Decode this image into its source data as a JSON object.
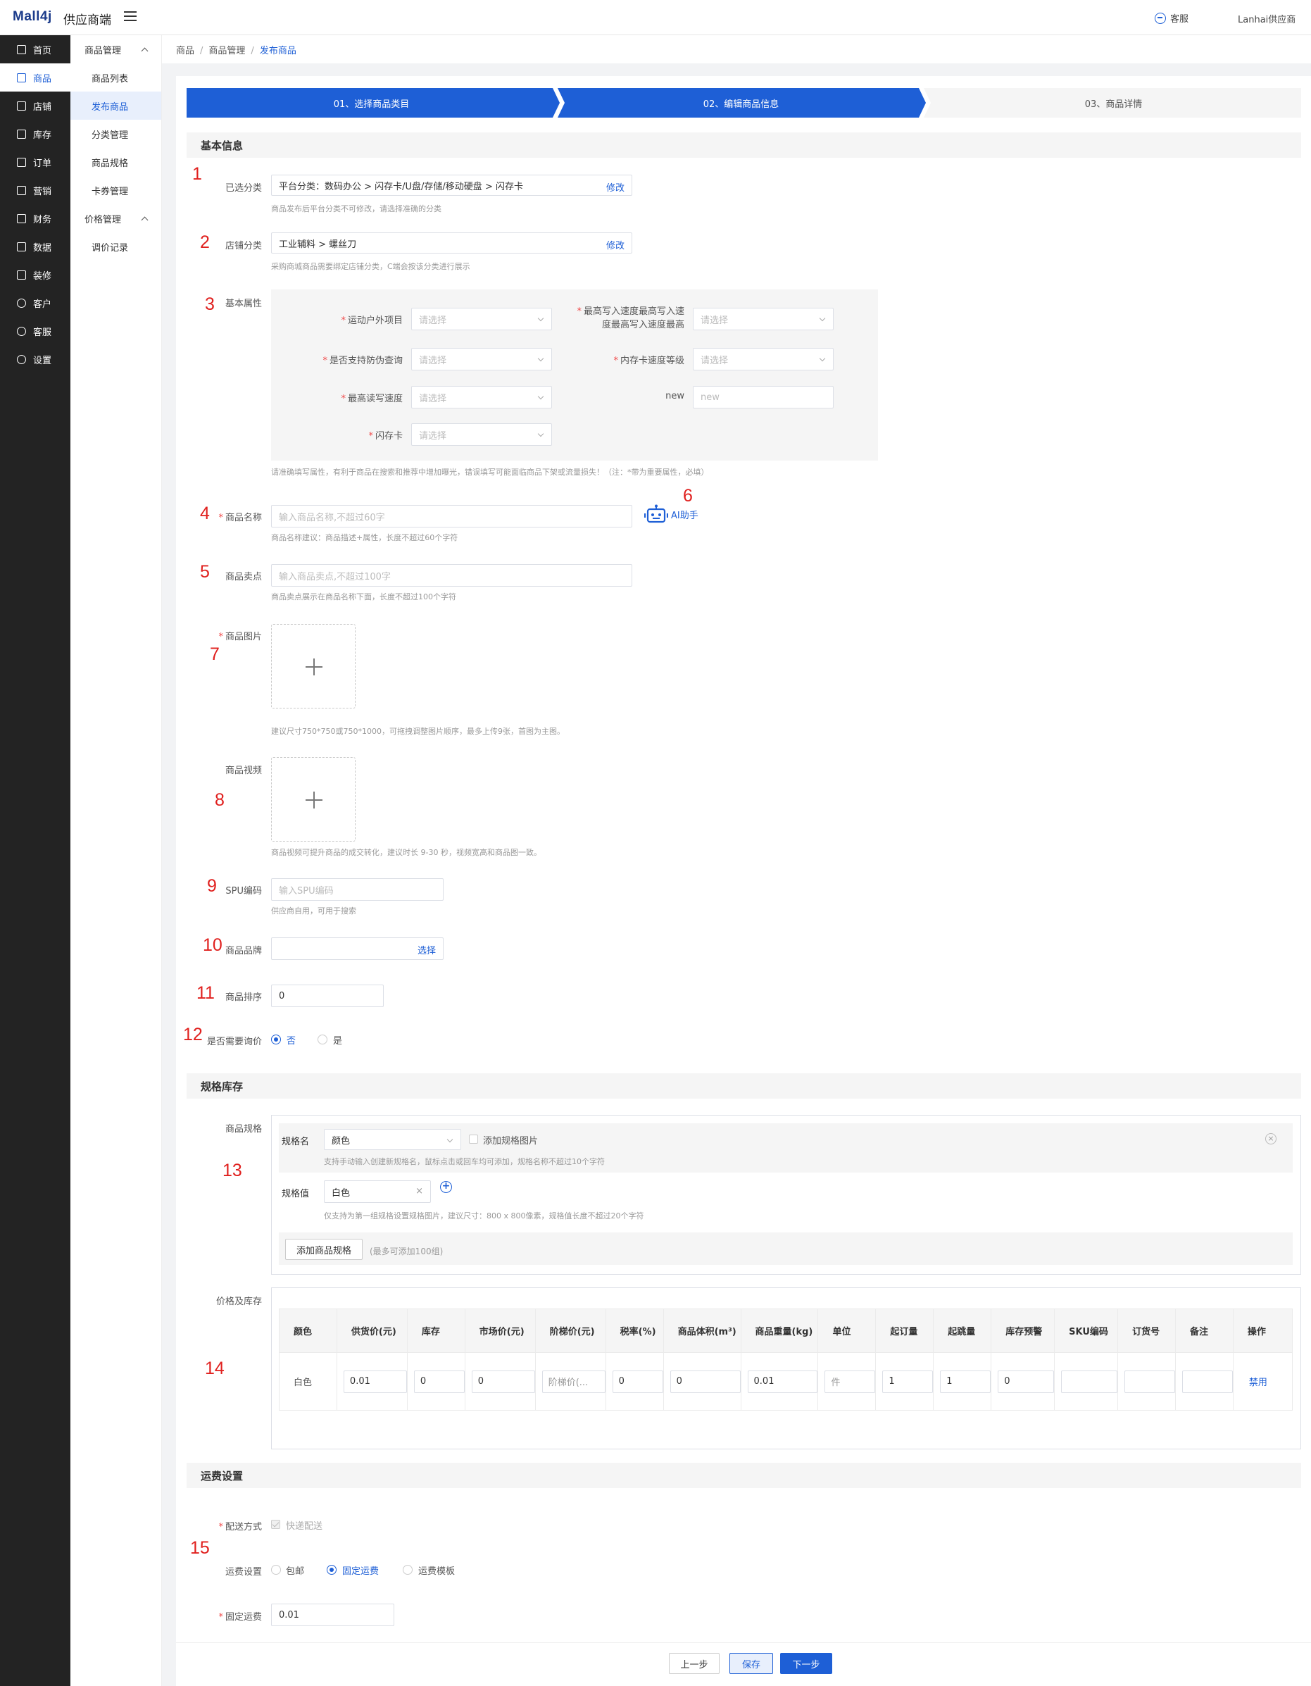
{
  "header": {
    "logo": "Mall4j",
    "logo_sub": "供应商端",
    "service": "客服",
    "user": "Lanhai供应商"
  },
  "leftnav": [
    {
      "label": "首页",
      "icon": "home-icon"
    },
    {
      "label": "商品",
      "icon": "product-icon"
    },
    {
      "label": "店铺",
      "icon": "shop-icon"
    },
    {
      "label": "库存",
      "icon": "inventory-icon"
    },
    {
      "label": "订单",
      "icon": "order-icon"
    },
    {
      "label": "营销",
      "icon": "marketing-icon"
    },
    {
      "label": "财务",
      "icon": "finance-icon"
    },
    {
      "label": "数据",
      "icon": "data-icon"
    },
    {
      "label": "装修",
      "icon": "decorate-icon"
    },
    {
      "label": "客户",
      "icon": "customer-icon"
    },
    {
      "label": "客服",
      "icon": "service-icon"
    },
    {
      "label": "设置",
      "icon": "settings-icon"
    }
  ],
  "subnav": {
    "group1": "商品管理",
    "items1": [
      "商品列表",
      "发布商品",
      "分类管理",
      "商品规格",
      "卡券管理"
    ],
    "group2": "价格管理",
    "items2": [
      "调价记录"
    ]
  },
  "breadcrumb": [
    "商品",
    "商品管理",
    "发布商品"
  ],
  "steps": [
    "01、选择商品类目",
    "02、编辑商品信息",
    "03、商品详情"
  ],
  "sections": {
    "basic": "基本信息",
    "spec": "规格库存",
    "freight": "运费设置"
  },
  "form": {
    "category_label": "已选分类",
    "category_value": "平台分类：数码办公 > 闪存卡/U盘/存储/移动硬盘 > 闪存卡",
    "category_edit": "修改",
    "category_hint": "商品发布后平台分类不可修改，请选择准确的分类",
    "shop_cat_label": "店铺分类",
    "shop_cat_value": "工业辅料 > 螺丝刀",
    "shop_cat_edit": "修改",
    "shop_cat_hint": "采购商城商品需要绑定店铺分类，C端会按该分类进行展示",
    "attr_label": "基本属性",
    "attrs": {
      "a1": "运动户外项目",
      "a2_line1": "最高写入速度最高写入速",
      "a2_line2": "度最高写入速度最高",
      "a3": "是否支持防伪查询",
      "a4": "内存卡速度等级",
      "a5": "最高读写速度",
      "a6": "new",
      "a7": "闪存卡",
      "select_ph": "请选择",
      "new_ph": "new"
    },
    "attr_hint": "请准确填写属性，有利于商品在搜索和推荐中增加曝光，错误填写可能面临商品下架或流量损失！（注：*带为重要属性，必填）",
    "name_label": "商品名称",
    "name_ph": "输入商品名称,不超过60字",
    "name_hint": "商品名称建议：商品描述+属性，长度不超过60个字符",
    "ai_label": "AI助手",
    "sell_label": "商品卖点",
    "sell_ph": "输入商品卖点,不超过100字",
    "sell_hint": "商品卖点展示在商品名称下面，长度不超过100个字符",
    "image_label": "商品图片",
    "image_hint": "建议尺寸750*750或750*1000，可拖拽调整图片顺序，最多上传9张，首图为主图。",
    "video_label": "商品视频",
    "video_hint": "商品视频可提升商品的成交转化，建议时长 9-30 秒，视频宽高和商品图一致。",
    "spu_label": "SPU编码",
    "spu_ph": "输入SPU编码",
    "spu_hint": "供应商自用，可用于搜索",
    "brand_label": "商品品牌",
    "brand_select": "选择",
    "sort_label": "商品排序",
    "sort_value": "0",
    "inquiry_label": "是否需要询价",
    "inquiry_no": "否",
    "inquiry_yes": "是"
  },
  "spec": {
    "label": "商品规格",
    "name_label": "规格名",
    "name_value": "颜色",
    "add_image": "添加规格图片",
    "name_hint": "支持手动输入创建新规格名，鼠标点击或回车均可添加，规格名称不超过10个字符",
    "value_label": "规格值",
    "value_tag": "白色",
    "value_hint": "仅支持为第一组规格设置规格图片，建议尺寸：800 x 800像素，规格值长度不超过20个字符",
    "add_btn": "添加商品规格",
    "add_hint": "(最多可添加100组)"
  },
  "price": {
    "label": "价格及库存",
    "headers": [
      "颜色",
      "供货价(元)",
      "库存",
      "市场价(元)",
      "阶梯价(元)",
      "税率(%)",
      "商品体积(m³)",
      "商品重量(kg)",
      "单位",
      "起订量",
      "起跳量",
      "库存预警",
      "SKU编码",
      "订货号",
      "备注",
      "操作"
    ],
    "row": {
      "color": "白色",
      "supply": "0.01",
      "stock": "0",
      "market": "0",
      "tier": "阶梯价(...",
      "tax": "0",
      "volume": "0",
      "weight": "0.01",
      "unit": "件",
      "moq": "1",
      "step": "1",
      "warn": "0",
      "action": "禁用"
    }
  },
  "freight": {
    "method_label": "配送方式",
    "method_value": "快递配送",
    "setting_label": "运费设置",
    "opt1": "包邮",
    "opt2": "固定运费",
    "opt3": "运费模板",
    "fixed_label": "固定运费",
    "fixed_value": "0.01"
  },
  "footer": {
    "prev": "上一步",
    "save": "保存",
    "next": "下一步"
  },
  "annotations": [
    "1",
    "2",
    "3",
    "4",
    "5",
    "6",
    "7",
    "8",
    "9",
    "10",
    "11",
    "12",
    "13",
    "14",
    "15"
  ],
  "colors": {
    "accent": "#1e5fd6",
    "nav_bg": "#232323",
    "annotation": "#e0201e"
  }
}
